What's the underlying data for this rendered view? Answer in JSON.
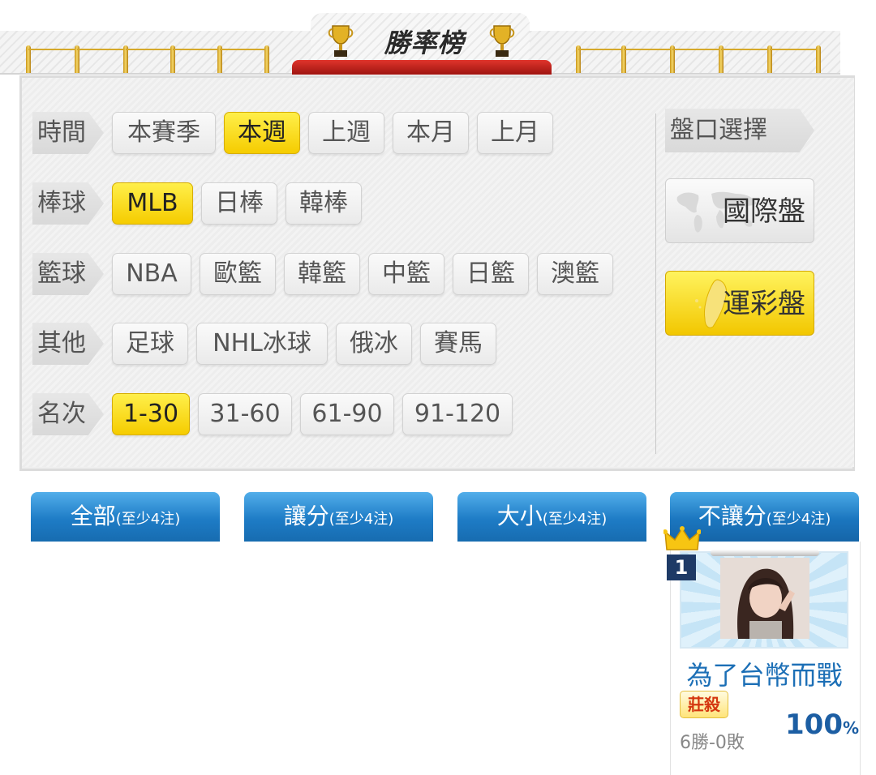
{
  "header": {
    "title": "勝率榜"
  },
  "filters": {
    "time": {
      "label": "時間",
      "options": [
        "本賽季",
        "本週",
        "上週",
        "本月",
        "上月"
      ],
      "selected": "本週"
    },
    "baseball": {
      "label": "棒球",
      "options": [
        "MLB",
        "日棒",
        "韓棒"
      ],
      "selected": "MLB"
    },
    "basketball": {
      "label": "籃球",
      "options": [
        "NBA",
        "歐籃",
        "韓籃",
        "中籃",
        "日籃",
        "澳籃"
      ]
    },
    "other": {
      "label": "其他",
      "options": [
        "足球",
        "NHL冰球",
        "俄冰",
        "賽馬"
      ]
    },
    "rank": {
      "label": "名次",
      "options": [
        "1-30",
        "31-60",
        "61-90",
        "91-120"
      ],
      "selected": "1-30"
    }
  },
  "market": {
    "label": "盤口選擇",
    "international": "國際盤",
    "local": "運彩盤",
    "selected": "運彩盤"
  },
  "tabs": [
    {
      "label": "全部",
      "note": "(至少4注)"
    },
    {
      "label": "讓分",
      "note": "(至少4注)"
    },
    {
      "label": "大小",
      "note": "(至少4注)"
    },
    {
      "label": "不讓分",
      "note": "(至少4注)"
    }
  ],
  "ranking": {
    "rank": "1",
    "name": "為了台幣而戰",
    "badge": "莊殺",
    "record": "6勝-0敗",
    "win_rate": "100",
    "win_rate_unit": "%"
  },
  "colors": {
    "selected_yellow": "#f5cc00",
    "tab_blue": "#1e7cc6",
    "name_blue": "#1c6fb6",
    "badge_red": "#d4360f"
  }
}
